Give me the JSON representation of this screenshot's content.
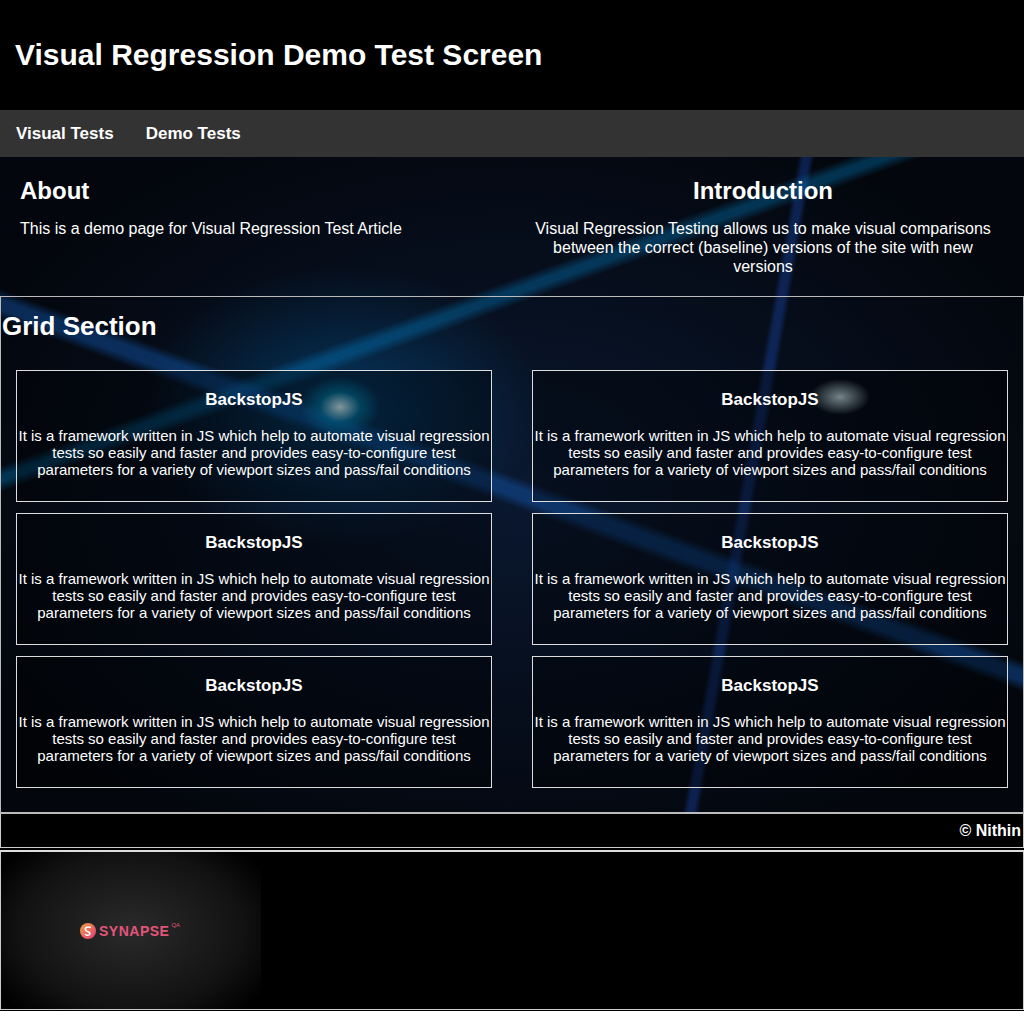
{
  "header": {
    "title": "Visual Regression Demo Test Screen"
  },
  "nav": {
    "items": [
      {
        "label": "Visual Tests"
      },
      {
        "label": "Demo Tests"
      }
    ]
  },
  "about": {
    "title": "About",
    "text": "This is a demo page for Visual Regression Test Article"
  },
  "introduction": {
    "title": "Introduction",
    "text": "Visual Regression Testing allows us to make visual comparisons between the correct (baseline) versions of the site with new versions"
  },
  "grid": {
    "title": "Grid Section",
    "cards": [
      {
        "title": "BackstopJS",
        "text": "It is a framework written in JS which help to automate visual regression tests so easily and faster and provides easy-to-configure test parameters for a variety of viewport sizes and pass/fail conditions"
      },
      {
        "title": "BackstopJS",
        "text": "It is a framework written in JS which help to automate visual regression tests so easily and faster and provides easy-to-configure test parameters for a variety of viewport sizes and pass/fail conditions"
      },
      {
        "title": "BackstopJS",
        "text": "It is a framework written in JS which help to automate visual regression tests so easily and faster and provides easy-to-configure test parameters for a variety of viewport sizes and pass/fail conditions"
      },
      {
        "title": "BackstopJS",
        "text": "It is a framework written in JS which help to automate visual regression tests so easily and faster and provides easy-to-configure test parameters for a variety of viewport sizes and pass/fail conditions"
      },
      {
        "title": "BackstopJS",
        "text": "It is a framework written in JS which help to automate visual regression tests so easily and faster and provides easy-to-configure test parameters for a variety of viewport sizes and pass/fail conditions"
      },
      {
        "title": "BackstopJS",
        "text": "It is a framework written in JS which help to automate visual regression tests so easily and faster and provides easy-to-configure test parameters for a variety of viewport sizes and pass/fail conditions"
      }
    ]
  },
  "footer": {
    "copyright": "© Nithin"
  },
  "logo": {
    "name": "SYNAPSE",
    "suffix": "QA"
  }
}
